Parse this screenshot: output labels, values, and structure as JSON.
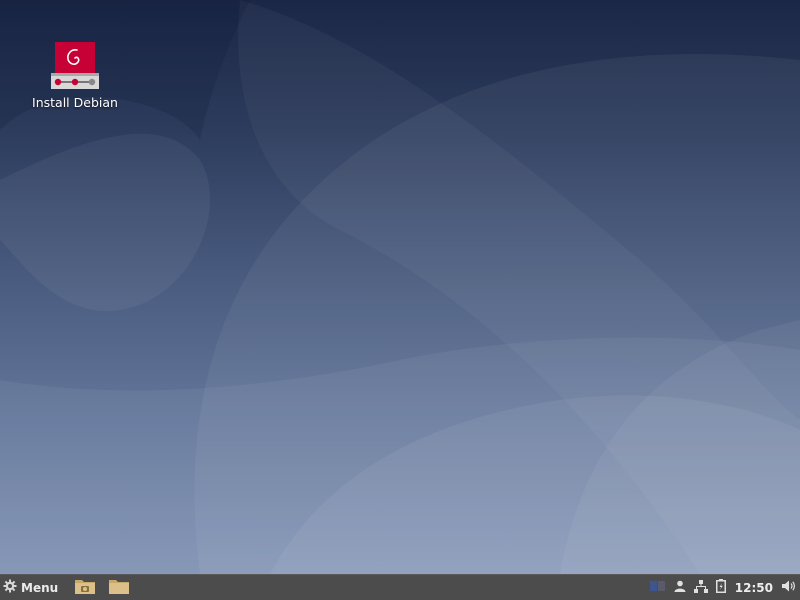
{
  "desktop": {
    "icons": [
      {
        "label": "Install Debian",
        "icon": "debian-installer-icon"
      }
    ]
  },
  "panel": {
    "menu": {
      "label": "Menu",
      "icon": "gear-icon"
    },
    "launchers": [
      {
        "icon": "file-manager-camera-folder-icon"
      },
      {
        "icon": "folder-icon"
      }
    ],
    "tray": [
      {
        "icon": "workspace-switcher-icon"
      },
      {
        "icon": "user-icon"
      },
      {
        "icon": "network-icon"
      },
      {
        "icon": "battery-icon"
      }
    ],
    "clock": "12:50",
    "volume_icon": "volume-icon"
  },
  "colors": {
    "debian_red": "#c70036",
    "panel_bg": "#4c4c4c"
  }
}
